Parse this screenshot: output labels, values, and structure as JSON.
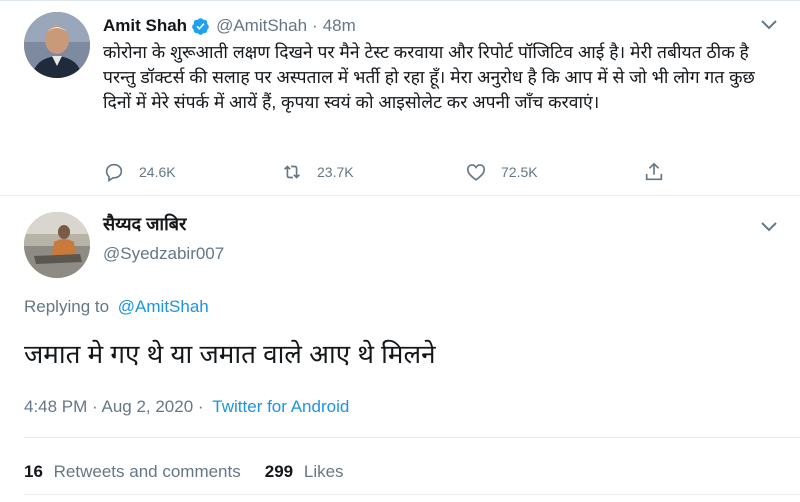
{
  "parent_tweet": {
    "author_name": "Amit Shah",
    "handle": "@AmitShah",
    "separator": "·",
    "time_ago": "48m",
    "text": "कोरोना के शुरूआती लक्षण दिखने पर मैने टेस्ट करवाया और रिपोर्ट पॉजिटिव आई है। मेरी तबीयत ठीक है परन्तु डॉक्टर्स की सलाह पर अस्पताल में भर्ती हो रहा हूँ। मेरा अनुरोध है कि आप में से जो भी लोग गत कुछ दिनों में मेरे संपर्क में आयें हैं, कृपया स्वयं को आइसोलेट कर अपनी जाँच करवाएं।",
    "actions": {
      "replies": "24.6K",
      "retweets": "23.7K",
      "likes": "72.5K"
    }
  },
  "reply_tweet": {
    "author_name": "सैय्यद जाबिर",
    "handle": "@Syedzabir007",
    "replying_prefix": "Replying to",
    "replying_to": "@AmitShah",
    "text": "जमात मे गए थे या जमात वाले आए थे मिलने",
    "timestamp": "4:48 PM · Aug 2, 2020 ·",
    "source": "Twitter for Android",
    "stats": {
      "retweets_count": "16",
      "retweets_label": "Retweets and comments",
      "likes_count": "299",
      "likes_label": "Likes"
    }
  },
  "colors": {
    "text_primary": "#14171a",
    "text_secondary": "#657786",
    "link": "#1b95e0",
    "verified": "#1da1f2",
    "divider": "#e6ecf0"
  },
  "icons": [
    "verified-icon",
    "chevron-down-icon",
    "reply-icon",
    "retweet-icon",
    "like-icon",
    "share-icon"
  ]
}
